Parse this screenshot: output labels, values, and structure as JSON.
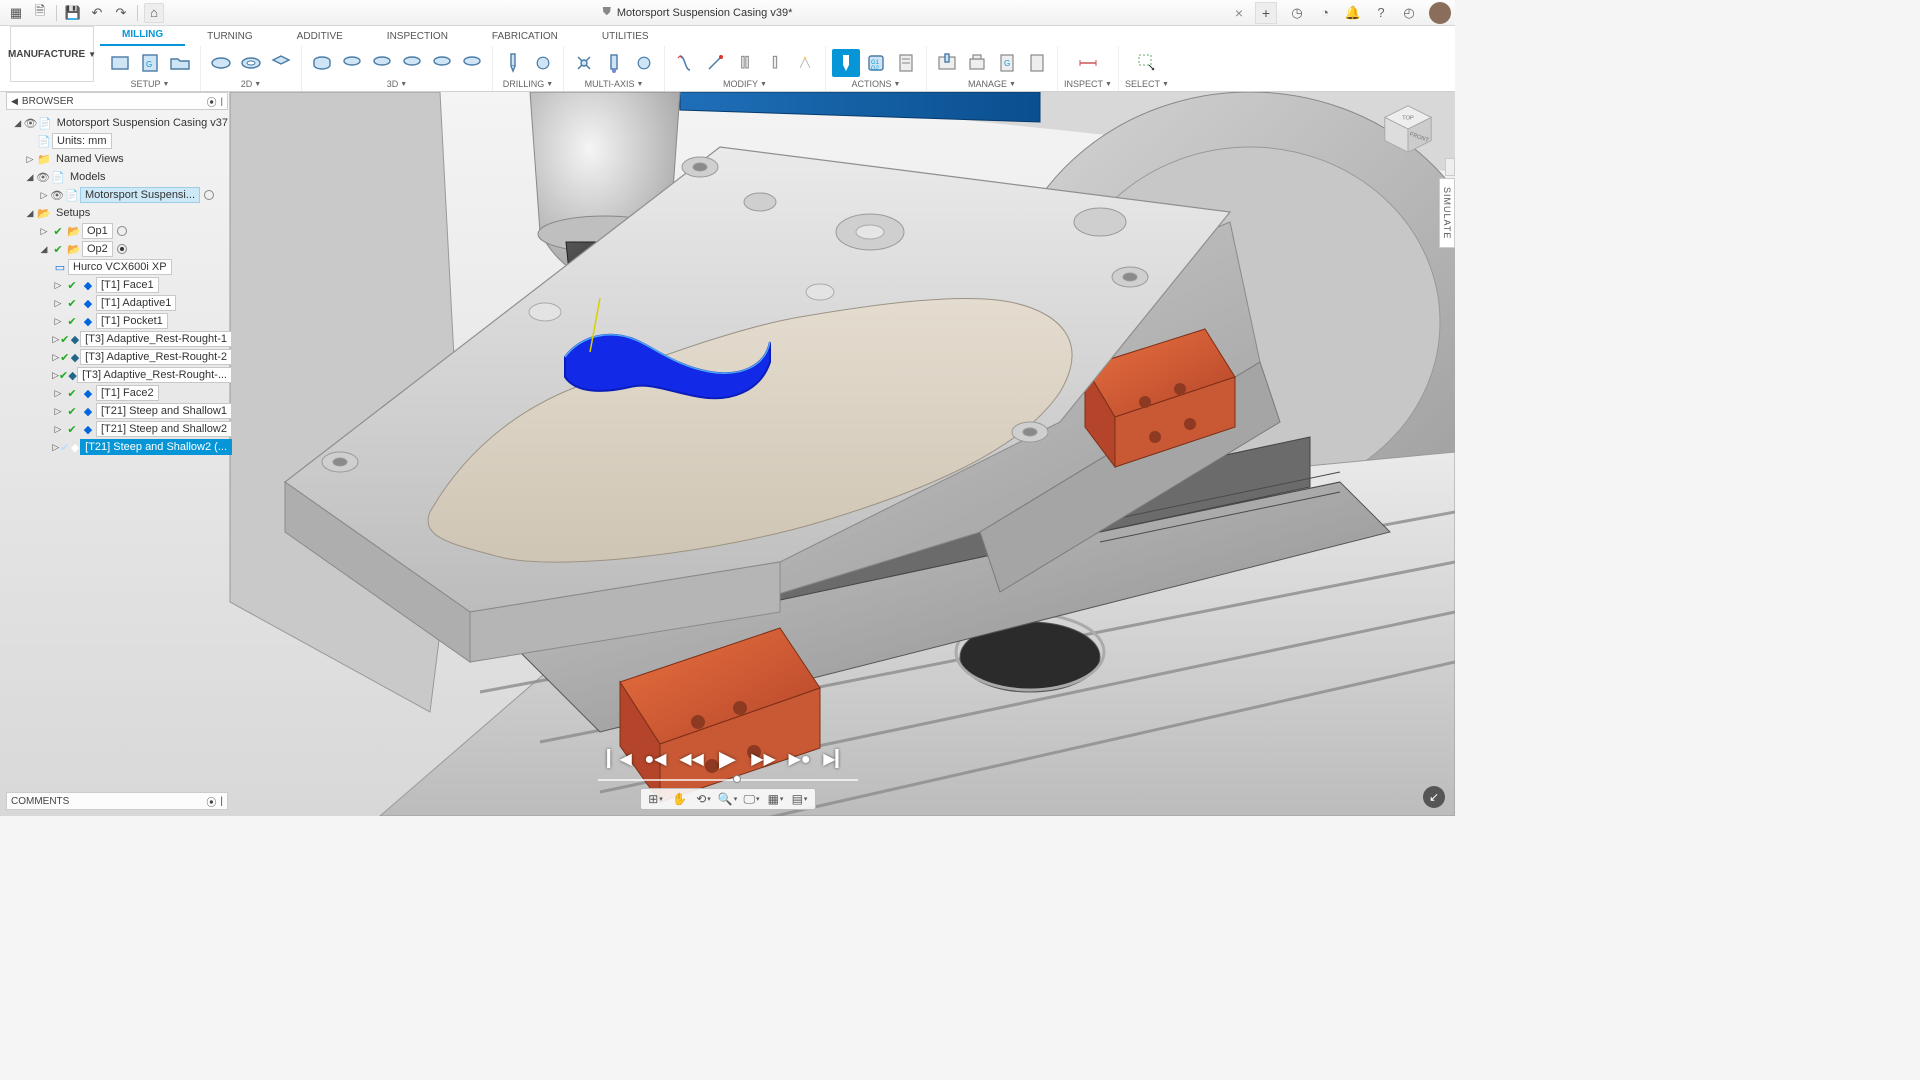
{
  "app": {
    "doc_title": "Motorsport Suspension Casing v39*",
    "workspace": "MANUFACTURE"
  },
  "tabs": {
    "items": [
      "MILLING",
      "TURNING",
      "ADDITIVE",
      "INSPECTION",
      "FABRICATION",
      "UTILITIES"
    ],
    "active": 0
  },
  "ribbon_groups": [
    "SETUP",
    "2D",
    "3D",
    "DRILLING",
    "MULTI-AXIS",
    "MODIFY",
    "ACTIONS",
    "MANAGE",
    "INSPECT",
    "SELECT"
  ],
  "browser": {
    "title": "BROWSER",
    "root": "Motorsport Suspension Casing v37",
    "units": "Units: mm",
    "named_views": "Named Views",
    "models": "Models",
    "model_item": "Motorsport Suspensi...",
    "setups": "Setups",
    "op1": "Op1",
    "op2": "Op2",
    "machine": "Hurco VCX600i XP",
    "ops": [
      "[T1] Face1",
      "[T1] Adaptive1",
      "[T1] Pocket1",
      "[T3] Adaptive_Rest-Rought-1",
      "[T3] Adaptive_Rest-Rought-2",
      "[T3] Adaptive_Rest-Rought-...",
      "[T1] Face2",
      "[T21] Steep and Shallow1",
      "[T21] Steep and Shallow2",
      "[T21] Steep and Shallow2 (..."
    ]
  },
  "comments": "COMMENTS",
  "simulate_tab": "SIMULATE",
  "viewcube": {
    "top": "TOP",
    "front": "FRONT"
  }
}
